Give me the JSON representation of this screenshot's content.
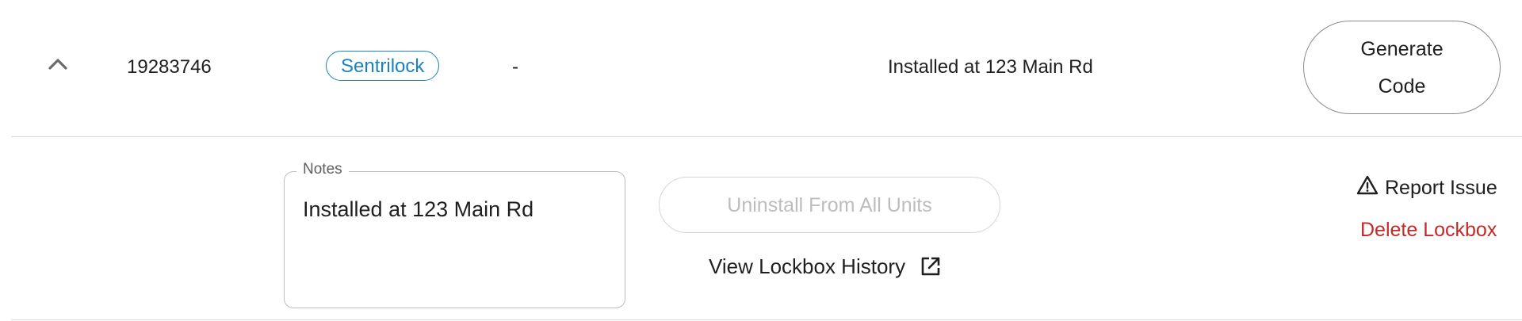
{
  "row": {
    "lockbox_id": "19283746",
    "brand_badge": "Sentrilock",
    "dash_value": "-",
    "note_summary": "Installed at 123 Main Rd",
    "generate_line1": "Generate",
    "generate_line2": "Code",
    "collapse_icon": "chevron-up-icon"
  },
  "details": {
    "notes_label": "Notes",
    "notes_value": "Installed at 123 Main Rd",
    "uninstall_label": "Uninstall From All Units",
    "history_label": "View Lockbox History",
    "history_icon": "external-link-icon",
    "report_label": "Report Issue",
    "report_icon": "warning-icon",
    "delete_label": "Delete Lockbox"
  },
  "colors": {
    "badge": "#1b82c0",
    "delete": "#c62828",
    "disabled_text": "#bdbdbd"
  }
}
